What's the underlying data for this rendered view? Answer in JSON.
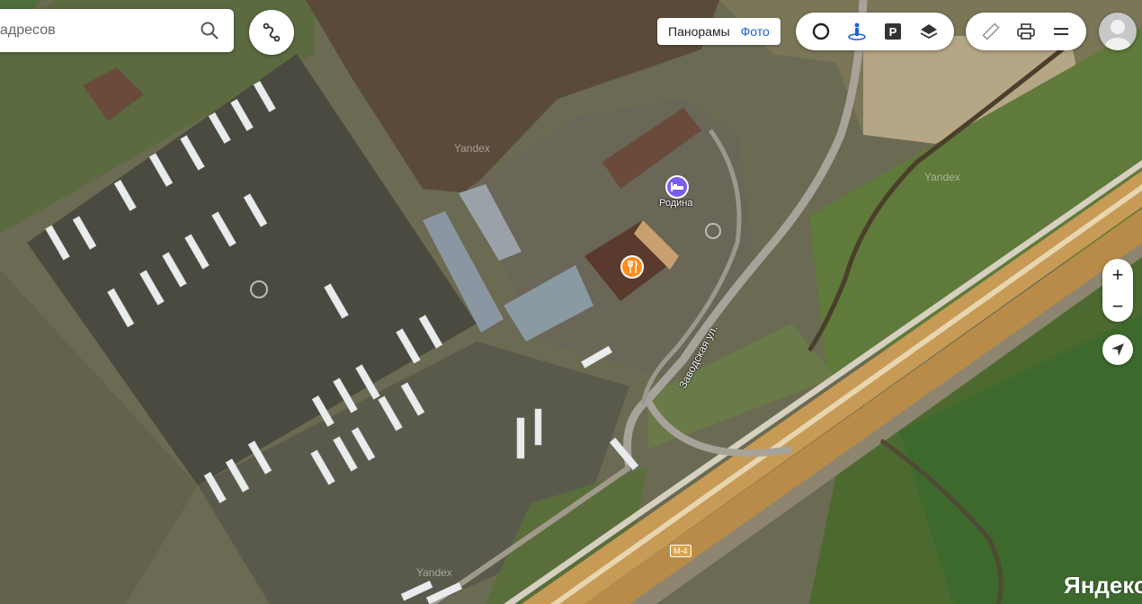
{
  "search": {
    "value": "адресов"
  },
  "panorama": {
    "panoramas_label": "Панорамы",
    "photo_label": "Фото"
  },
  "controls": {
    "traffic_icon": "traffic-ring-icon",
    "panorama_man_icon": "panorama-man-icon",
    "parking_label": "P",
    "layers_icon": "layers-icon",
    "ruler_icon": "ruler-icon",
    "print_icon": "printer-icon",
    "menu_icon": "menu-icon",
    "zoom_in_label": "+",
    "zoom_out_label": "−"
  },
  "map": {
    "watermarks": [
      "Yandex",
      "Yandex",
      "Yandex"
    ],
    "poi": [
      {
        "name": "Родина",
        "icon": "hotel-icon",
        "color": "#7b5cf0"
      },
      {
        "name": "",
        "icon": "restaurant-icon",
        "color": "#ff8c1a"
      }
    ],
    "street_label": "Заводская ул.",
    "highway_label": "М-4",
    "logo": "Яндекс"
  }
}
